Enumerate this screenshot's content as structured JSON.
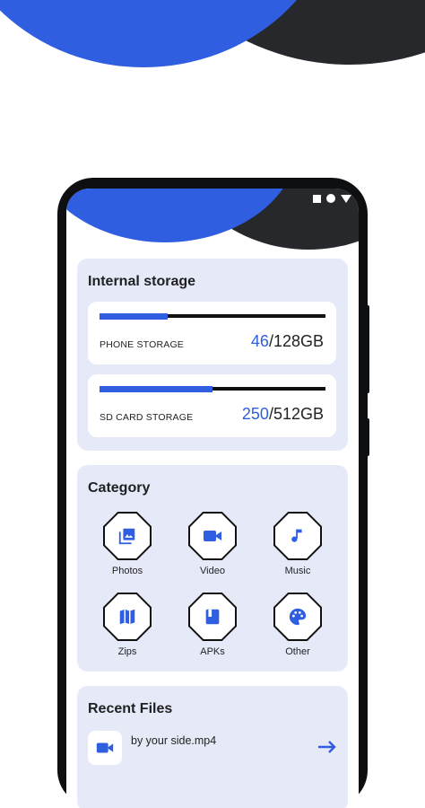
{
  "colors": {
    "accent": "#2f5ee0",
    "dark": "#26282c",
    "card": "#e6e9f8"
  },
  "status_bar": {
    "icons": [
      "square-icon",
      "circle-icon",
      "triangle-icon"
    ]
  },
  "internal_storage": {
    "title": "Internal storage",
    "items": [
      {
        "label": "PHONE STORAGE",
        "used": "46",
        "total": "/128GB",
        "fill_fraction": 0.3
      },
      {
        "label": "SD CARD STORAGE",
        "used": "250",
        "total": "/512GB",
        "fill_fraction": 0.5
      }
    ]
  },
  "category": {
    "title": "Category",
    "items": [
      {
        "label": "Photos",
        "icon": "photos-icon"
      },
      {
        "label": "Video",
        "icon": "video-icon"
      },
      {
        "label": "Music",
        "icon": "music-icon"
      },
      {
        "label": "Zips",
        "icon": "map-icon"
      },
      {
        "label": "APKs",
        "icon": "book-icon"
      },
      {
        "label": "Other",
        "icon": "palette-icon"
      }
    ]
  },
  "recent_files": {
    "title": "Recent Files",
    "items": [
      {
        "name": "by your side.mp4",
        "icon": "video-icon"
      }
    ]
  }
}
